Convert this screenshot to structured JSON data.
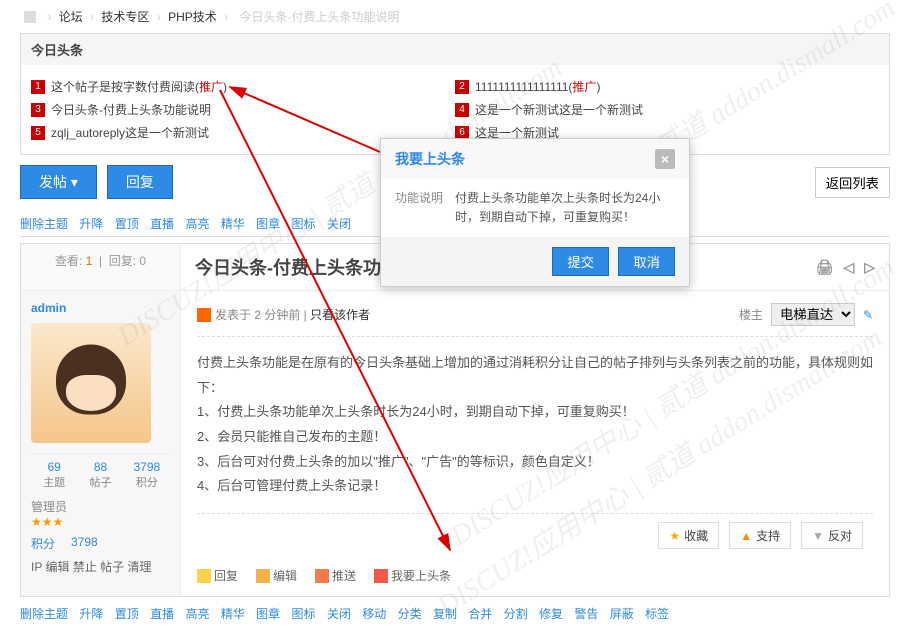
{
  "breadcrumb": {
    "forum": "论坛",
    "tech": "技术专区",
    "php": "PHP技术",
    "current": "今日头条-付费上头条功能说明"
  },
  "headlines": {
    "title": "今日头条",
    "items": [
      {
        "n": "1",
        "text": "这个帖子是按字数付费阅读(",
        "promo": "推广",
        "suffix": ")"
      },
      {
        "n": "2",
        "text": "1111111111111111(",
        "promo": "推广",
        "suffix": ")"
      },
      {
        "n": "3",
        "text": "今日头条-付费上头条功能说明"
      },
      {
        "n": "4",
        "text": "这是一个新测试这是一个新测试"
      },
      {
        "n": "5",
        "text": "zqlj_autoreply这是一个新测试"
      },
      {
        "n": "6",
        "text": "这是一个新测试"
      }
    ]
  },
  "actionbar": {
    "post": "发帖",
    "reply": "回复",
    "back": "返回列表"
  },
  "modtools": [
    "删除主题",
    "升降",
    "置顶",
    "直播",
    "高亮",
    "精华",
    "图章",
    "图标",
    "关闭",
    "移动",
    "分类",
    "复制",
    "合并",
    "分割",
    "修复",
    "警告",
    "屏蔽",
    "标签"
  ],
  "stats": {
    "view_label": "查看:",
    "view_n": "1",
    "reply_label": "回复:",
    "reply_n": "0"
  },
  "thread": {
    "title": "今日头条-付费上头条功能说明",
    "print": "🖨",
    "prev": "◁",
    "next": "▷"
  },
  "post": {
    "author": "admin",
    "posted_at": "发表于 2 分钟前",
    "only_author": "只看该作者",
    "floor": "楼主",
    "elevator": "电梯直达",
    "body": [
      "付费上头条功能是在原有的今日头条基础上增加的通过消耗积分让自己的帖子排列与头条列表之前的功能，具体规则如下：",
      "1、付费上头条功能单次上头条时长为24小时，到期自动下掉，可重复购买！",
      "2、会员只能推自己发布的主题！",
      "3、后台可对付费上头条的加以\"推广\"、\"广告\"的等标识，颜色自定义！",
      "4、后台可管理付费上头条记录！"
    ],
    "stats": {
      "threads": "69",
      "threads_l": "主题",
      "posts": "88",
      "posts_l": "帖子",
      "points": "3798",
      "points_l": "积分"
    },
    "role": "管理员",
    "points_label": "积分",
    "points_v": "3798",
    "tags": "IP 编辑 禁止 帖子 清理",
    "collect": "收藏",
    "support": "支持",
    "oppose": "反对",
    "actions": {
      "reply": "回复",
      "edit": "编辑",
      "push": "推送",
      "tohead": "我要上头条"
    }
  },
  "modal": {
    "title": "我要上头条",
    "label": "功能说明",
    "desc": "付费上头条功能单次上头条时长为24小时，到期自动下掉，可重复购买！",
    "submit": "提交",
    "cancel": "取消"
  },
  "watermark": "DISCUZ!应用中心 | 贰道  addon.dismall.com"
}
